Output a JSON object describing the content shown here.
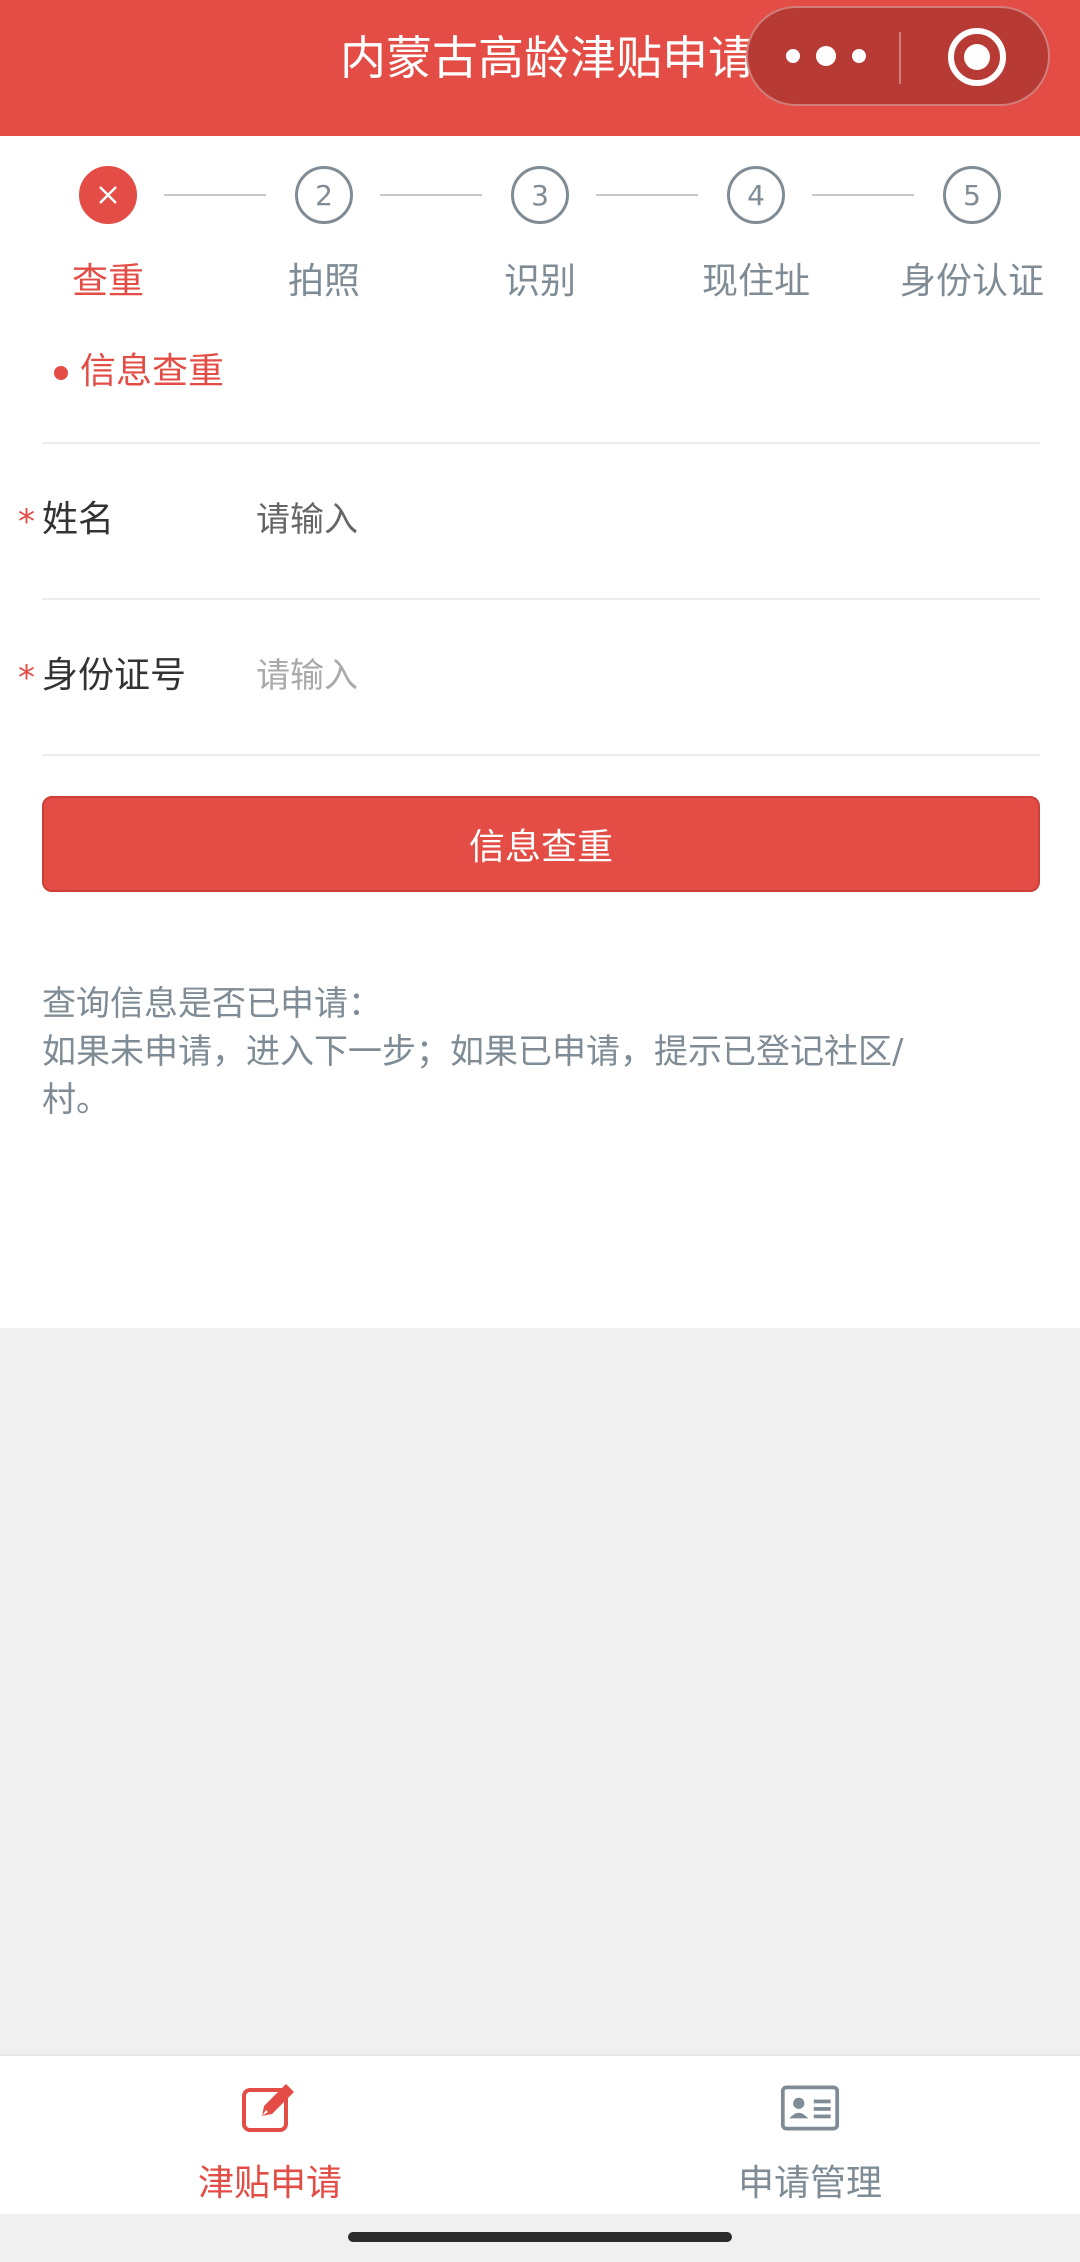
{
  "header": {
    "title": "内蒙古高龄津贴申请"
  },
  "steps": [
    {
      "number": "",
      "label": "查重",
      "active": true
    },
    {
      "number": "2",
      "label": "拍照",
      "active": false
    },
    {
      "number": "3",
      "label": "识别",
      "active": false
    },
    {
      "number": "4",
      "label": "现住址",
      "active": false
    },
    {
      "number": "5",
      "label": "身份认证",
      "active": false
    }
  ],
  "section": {
    "title": "信息查重"
  },
  "form": {
    "required_mark": "*",
    "name_label": "姓名",
    "name_placeholder": "请输入",
    "id_label": "身份证号",
    "id_placeholder": "请输入",
    "submit_label": "信息查重"
  },
  "note": {
    "line1": "查询信息是否已申请：",
    "line2": "如果未申请，进入下一步；如果已申请，提示已登记社区/",
    "line3": "村。"
  },
  "tabbar": {
    "tabs": [
      {
        "label": "津贴申请",
        "icon": "edit-icon",
        "active": true
      },
      {
        "label": "申请管理",
        "icon": "id-card-icon",
        "active": false
      }
    ]
  },
  "colors": {
    "brand": "#e34d45",
    "inactive": "#7f8c95"
  }
}
